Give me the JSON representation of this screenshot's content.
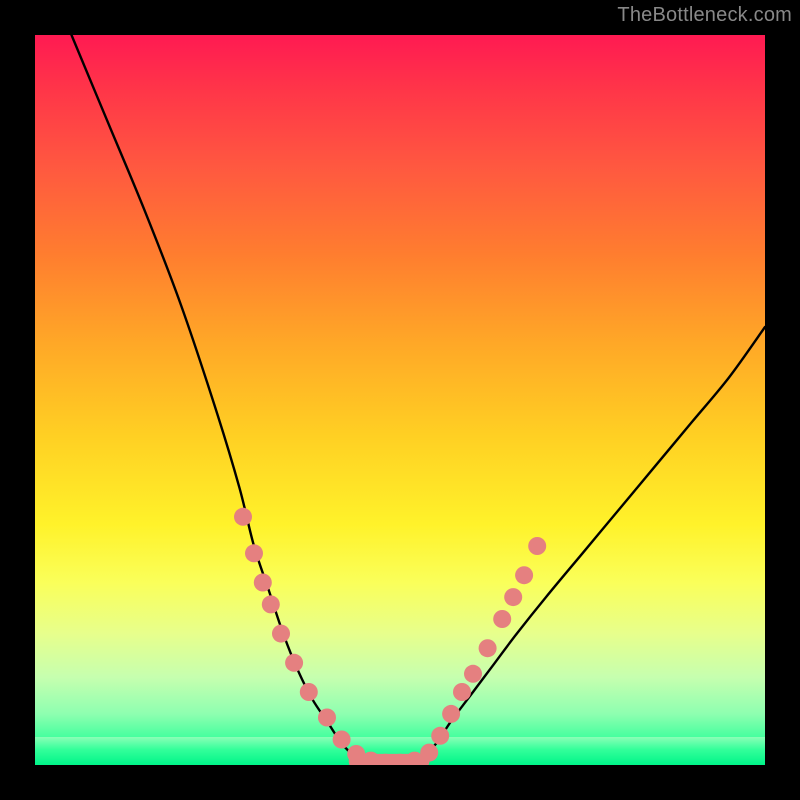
{
  "watermark_text": "TheBottleneck.com",
  "chart_data": {
    "type": "line",
    "title": "",
    "xlabel": "",
    "ylabel": "",
    "ylim": [
      0,
      100
    ],
    "xlim": [
      0,
      100
    ],
    "series": [
      {
        "name": "bottleneck-curve",
        "x": [
          5,
          10,
          15,
          20,
          25,
          28,
          30,
          32,
          34,
          36,
          38,
          40,
          42,
          44,
          46,
          47,
          50,
          53,
          55,
          57,
          60,
          63,
          66,
          70,
          75,
          80,
          85,
          90,
          95,
          100
        ],
        "y": [
          100,
          88,
          76,
          63,
          48,
          38,
          30,
          24,
          18,
          13,
          9,
          6,
          3,
          1,
          0,
          0,
          0,
          1,
          3,
          6,
          10,
          14,
          18,
          23,
          29,
          35,
          41,
          47,
          53,
          60
        ]
      }
    ],
    "markers": {
      "name": "highlight-dots",
      "color": "#e58080",
      "points": [
        {
          "x": 28.5,
          "y": 34
        },
        {
          "x": 30,
          "y": 29
        },
        {
          "x": 31.2,
          "y": 25
        },
        {
          "x": 32.3,
          "y": 22
        },
        {
          "x": 33.7,
          "y": 18
        },
        {
          "x": 35.5,
          "y": 14
        },
        {
          "x": 37.5,
          "y": 10
        },
        {
          "x": 40,
          "y": 6.5
        },
        {
          "x": 42,
          "y": 3.5
        },
        {
          "x": 44,
          "y": 1.5
        },
        {
          "x": 46,
          "y": 0.6
        },
        {
          "x": 48,
          "y": 0.3
        },
        {
          "x": 50,
          "y": 0.3
        },
        {
          "x": 52,
          "y": 0.6
        },
        {
          "x": 54,
          "y": 1.7
        },
        {
          "x": 55.5,
          "y": 4
        },
        {
          "x": 57,
          "y": 7
        },
        {
          "x": 58.5,
          "y": 10
        },
        {
          "x": 60,
          "y": 12.5
        },
        {
          "x": 62,
          "y": 16
        },
        {
          "x": 64,
          "y": 20
        },
        {
          "x": 65.5,
          "y": 23
        },
        {
          "x": 67,
          "y": 26
        },
        {
          "x": 68.8,
          "y": 30
        }
      ]
    },
    "flat_segment": {
      "x0": 44,
      "x1": 53,
      "y": 0.5,
      "color": "#e58080",
      "width": 15
    }
  }
}
